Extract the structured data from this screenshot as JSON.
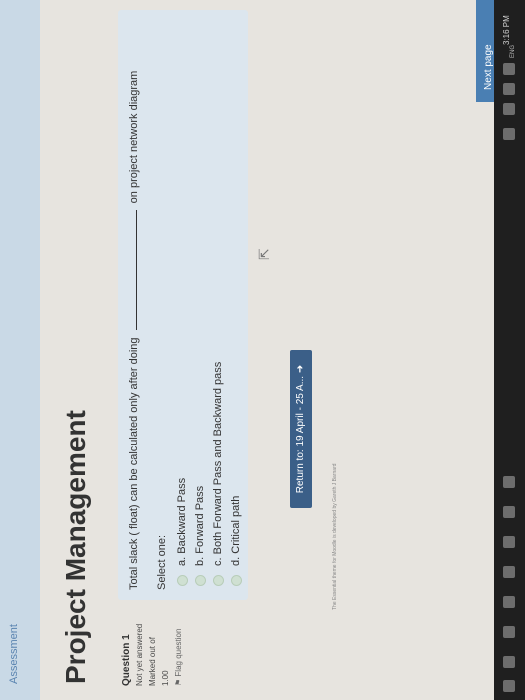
{
  "breadcrumb": "Assessment",
  "page_title": "Project Management",
  "question_info": {
    "number": "Question 1",
    "status": "Not yet answered",
    "marked": "Marked out of",
    "mark_value": "1.00",
    "flag": "Flag question"
  },
  "question": {
    "text_before": "Total slack ( float) can be calculated only after doing",
    "text_after": "on project network diagram",
    "select_label": "Select one:",
    "options": [
      "a. Backward Pass",
      "b. Forward Pass",
      "c. Both Forward Pass and Backward pass",
      "d. Critical path"
    ]
  },
  "return_button": "Return to: 19 April - 25 A...",
  "return_arrow": "➜",
  "next_button": "Next page",
  "footer": "The Essential theme for Moodle is developed by Gareth J Barnard",
  "taskbar": {
    "time": "3:16 PM",
    "lang": "ENG"
  }
}
